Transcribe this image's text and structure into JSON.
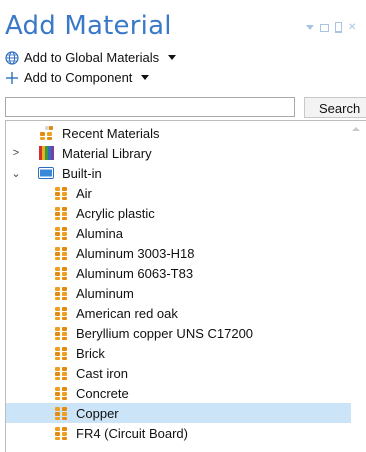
{
  "header": {
    "title": "Add Material"
  },
  "actions": {
    "add_global": "Add to Global Materials",
    "add_component": "Add to Component"
  },
  "search": {
    "value": "",
    "button_label": "Search"
  },
  "tree": {
    "recent": "Recent Materials",
    "library": "Material Library",
    "builtin": "Built-in",
    "materials": [
      "Air",
      "Acrylic plastic",
      "Alumina",
      "Aluminum 3003-H18",
      "Aluminum 6063-T83",
      "Aluminum",
      "American red oak",
      "Beryllium copper UNS C17200",
      "Brick",
      "Cast iron",
      "Concrete",
      "Copper",
      "FR4 (Circuit Board)"
    ],
    "selected": "Copper"
  }
}
